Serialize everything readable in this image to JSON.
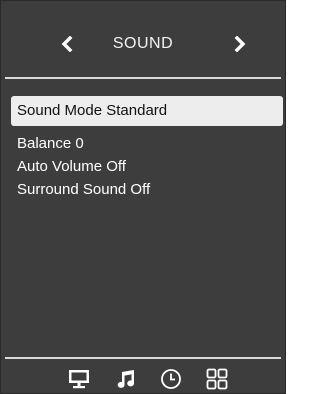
{
  "header": {
    "title": "SOUND",
    "prev_icon": "chevron-left-icon",
    "next_icon": "chevron-right-icon"
  },
  "menu": {
    "items": [
      {
        "label": "Sound Mode",
        "value": "Standard",
        "selected": true
      },
      {
        "label": "Balance",
        "value": "0",
        "selected": false
      },
      {
        "label": "Auto Volume",
        "value": "Off",
        "selected": false
      },
      {
        "label": "Surround Sound",
        "value": "Off",
        "selected": false
      }
    ]
  },
  "footer": {
    "icons": [
      "monitor-icon",
      "music-note-icon",
      "clock-icon",
      "grid-icon"
    ]
  },
  "colors": {
    "background": "#3d3d3d",
    "highlight": "#ededed",
    "text": "#ffffff",
    "divider": "#d9d9d9"
  }
}
